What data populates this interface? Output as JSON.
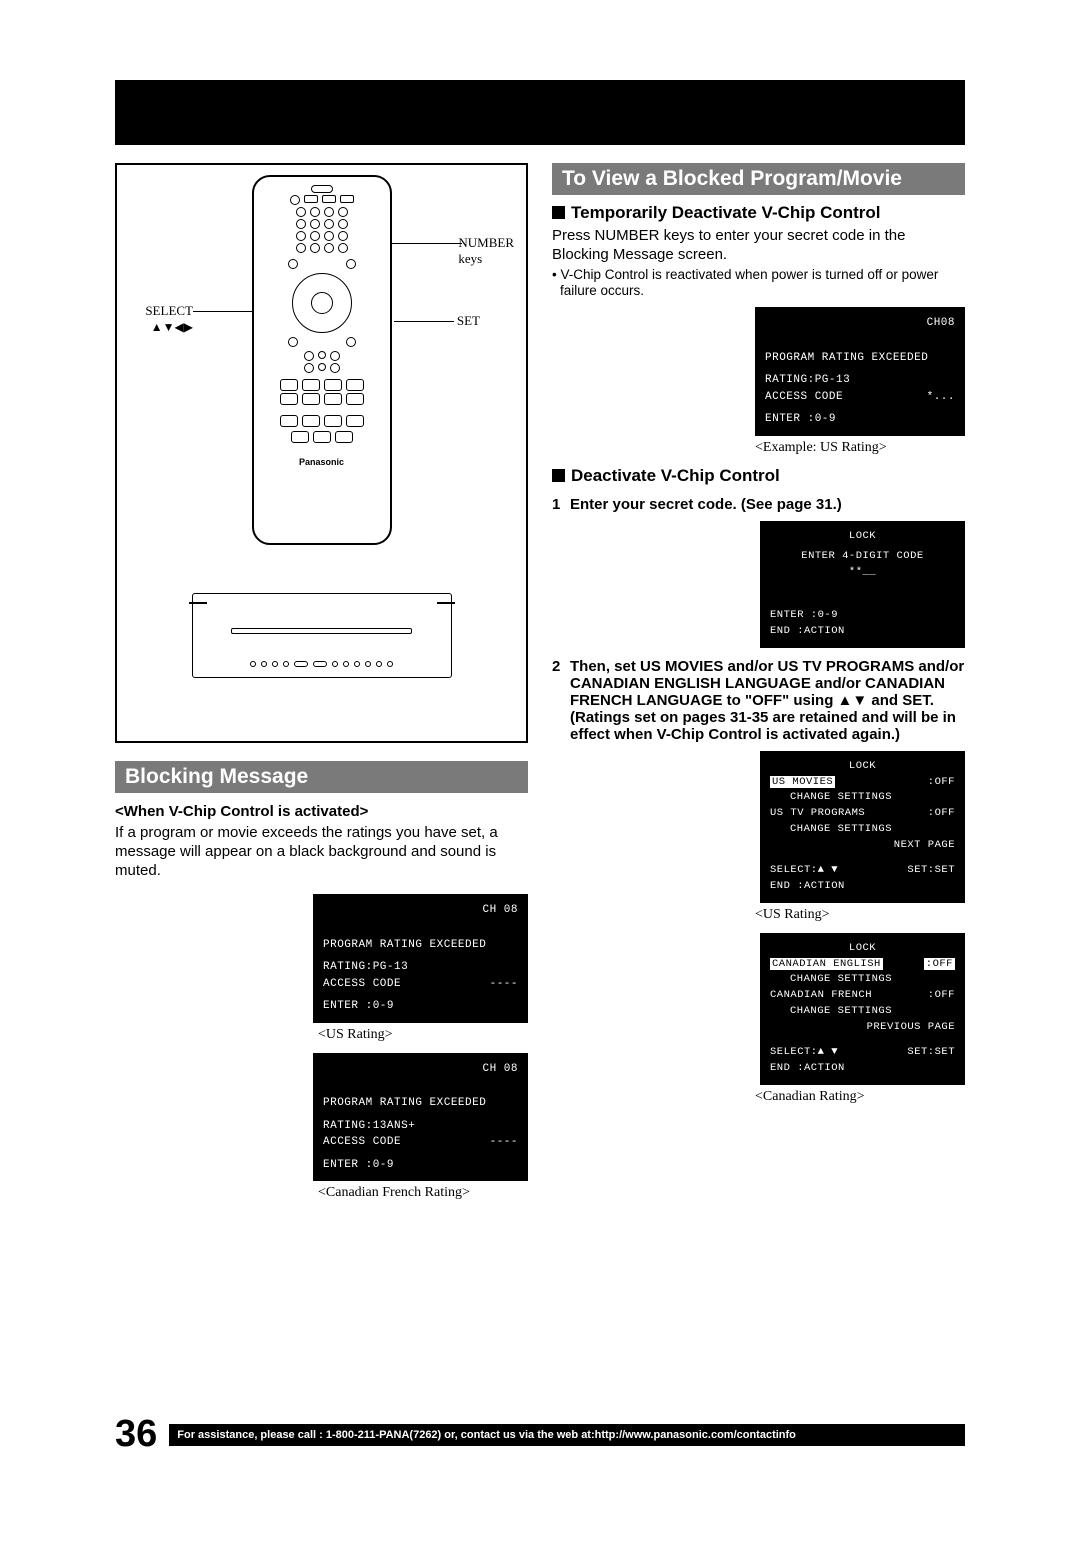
{
  "page_number": "36",
  "footer_text": "For assistance, please call : 1-800-211-PANA(7262) or, contact us via the web at:http://www.panasonic.com/contactinfo",
  "remote": {
    "label_select": "SELECT",
    "label_select_arrows": "▲▼◀▶",
    "label_number": "NUMBER",
    "label_keys": "keys",
    "label_set": "SET",
    "brand": "Panasonic"
  },
  "left": {
    "section_title": "Blocking Message",
    "sub1": "<When V-Chip Control is activated>",
    "body1": "If a program or movie exceeds the ratings you have set, a message will appear on a black background and sound is muted.",
    "osd1": {
      "ch": "CH 08",
      "l1": "PROGRAM RATING EXCEEDED",
      "l2a": "RATING:PG-13",
      "l2b": "ACCESS CODE",
      "l2c": "----",
      "l3": " ENTER :0-9"
    },
    "caption1": "<US Rating>",
    "osd2": {
      "ch": "CH 08",
      "l1": "PROGRAM RATING EXCEEDED",
      "l2a": "RATING:13ANS+",
      "l2b": "ACCESS CODE",
      "l2c": "----",
      "l3": " ENTER :0-9"
    },
    "caption2": "<Canadian French Rating>"
  },
  "right": {
    "section_title": "To View a Blocked Program/Movie",
    "h1": "Temporarily Deactivate V-Chip Control",
    "p1": "Press NUMBER keys to enter your secret code in the Blocking Message screen.",
    "b1": "• V-Chip Control is reactivated when power is turned off or power failure occurs.",
    "osd1": {
      "ch": "CH08",
      "l1": "PROGRAM RATING EXCEEDED",
      "l2a": "RATING:PG-13",
      "l2b": "ACCESS CODE",
      "l2c": "*...",
      "l3": " ENTER :0-9"
    },
    "caption1": "<Example: US Rating>",
    "h2": "Deactivate V-Chip Control",
    "step1": "Enter your secret code. (See page 31.)",
    "osd2": {
      "title": "LOCK",
      "l1": "ENTER 4-DIGIT CODE",
      "l2": "**__",
      "f1": "ENTER :0-9",
      "f2": "END   :ACTION"
    },
    "step2": "Then, set US MOVIES and/or US TV PROGRAMS and/or CANADIAN ENGLISH LANGUAGE and/or CANADIAN FRENCH LANGUAGE to \"OFF\" using ▲▼ and SET. (Ratings set on pages 31-35 are retained and will be in effect when V-Chip Control is activated again.)",
    "osd3": {
      "title": "LOCK",
      "r1a": "US MOVIES",
      "r1b": ":OFF",
      "r2": "CHANGE SETTINGS",
      "r3a": "US TV PROGRAMS",
      "r3b": ":OFF",
      "r4": "CHANGE SETTINGS",
      "r5": "NEXT PAGE",
      "f1": "SELECT:▲ ▼",
      "f1b": "SET:SET",
      "f2": "END   :ACTION"
    },
    "caption3": "<US Rating>",
    "osd4": {
      "title": "LOCK",
      "r1a": "CANADIAN ENGLISH",
      "r1b": ":OFF",
      "r2": "CHANGE SETTINGS",
      "r3a": "CANADIAN FRENCH",
      "r3b": ":OFF",
      "r4": "CHANGE SETTINGS",
      "r5": "PREVIOUS PAGE",
      "f1": "SELECT:▲ ▼",
      "f1b": "SET:SET",
      "f2": "END   :ACTION"
    },
    "caption4": "<Canadian Rating>"
  }
}
